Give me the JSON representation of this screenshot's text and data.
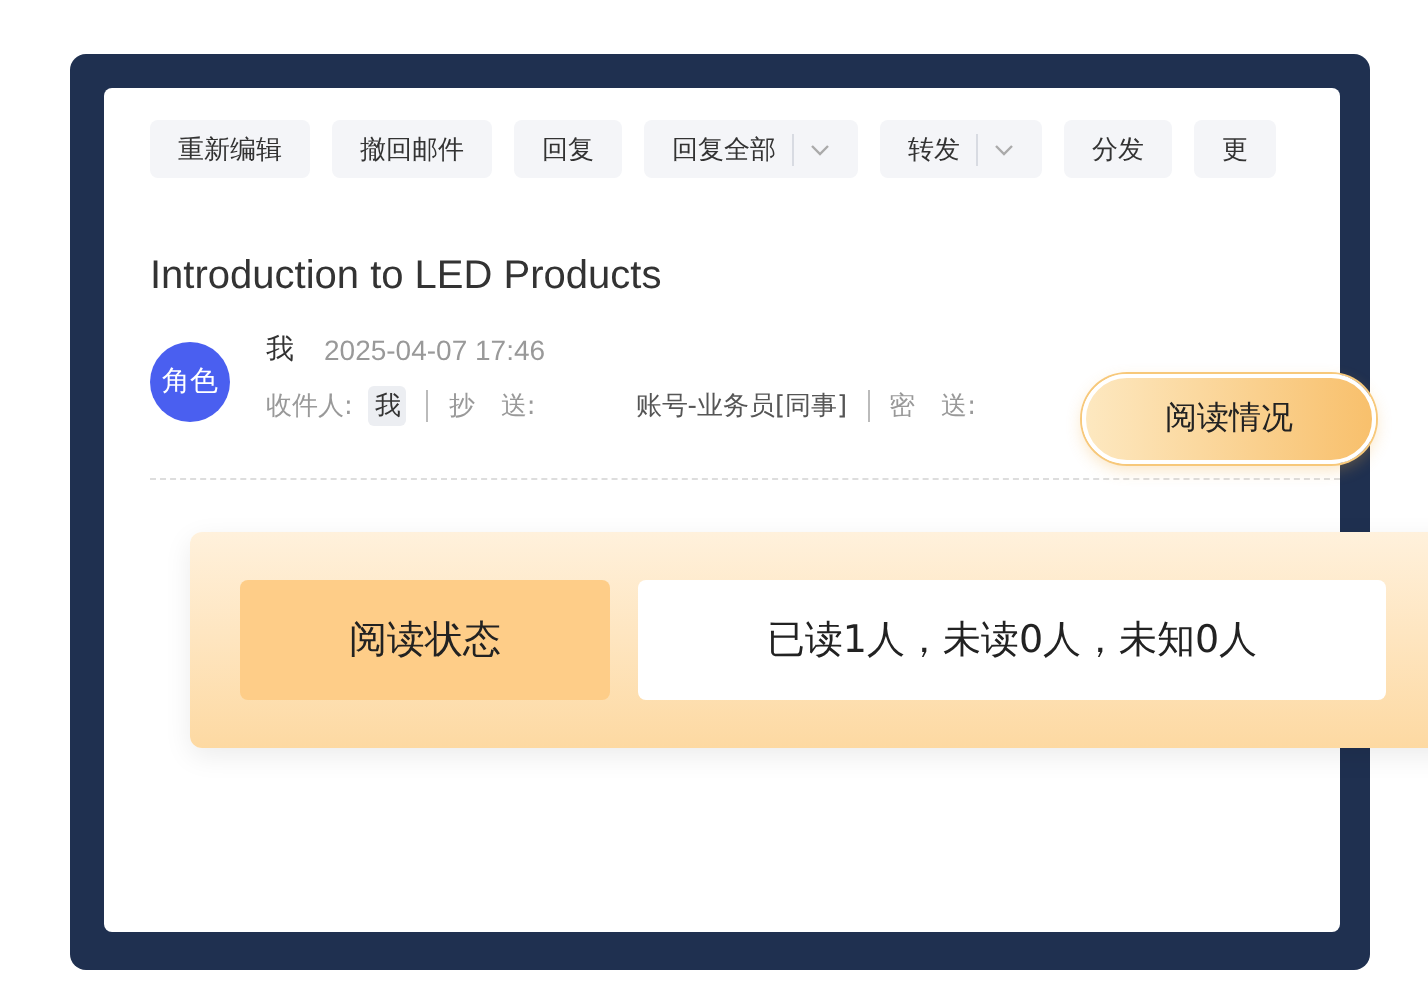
{
  "toolbar": [
    {
      "label": "重新编辑",
      "kind": "plain"
    },
    {
      "label": "撤回邮件",
      "kind": "plain"
    },
    {
      "label": "回复",
      "kind": "plain"
    },
    {
      "label": "回复全部",
      "kind": "split"
    },
    {
      "label": "转发",
      "kind": "split"
    },
    {
      "label": "分发",
      "kind": "plain"
    },
    {
      "label": "更",
      "kind": "plain"
    }
  ],
  "mail": {
    "subject": "Introduction to LED Products",
    "avatar": "角色",
    "sender": "我",
    "date": "2025-04-07 17:46",
    "to_label": "收件人:",
    "to": "我",
    "cc_label": "抄　送:",
    "cc": "账号-业务员[同事]",
    "bcc_label": "密　送:"
  },
  "read_button": "阅读情况",
  "read_status": {
    "label": "阅读状态",
    "value": "已读1人，未读0人，未知0人"
  }
}
